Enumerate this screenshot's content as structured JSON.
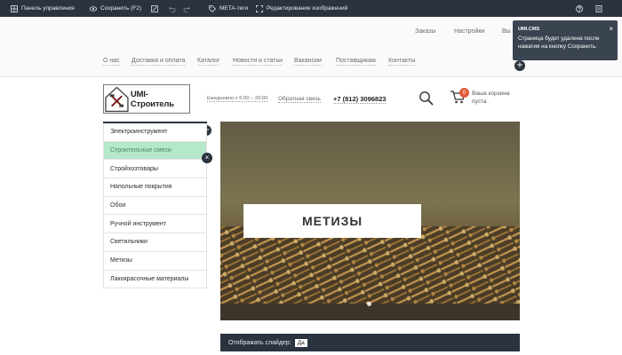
{
  "adminbar": {
    "control_panel": "Панель управления",
    "save": "Сохранить (F2)",
    "meta_tags": "META-теги",
    "edit_images": "Редактирование изображений"
  },
  "topnav": {
    "items": [
      "Заказы",
      "Настройки",
      "Вы"
    ]
  },
  "mainnav": {
    "items": [
      "О нас",
      "Доставка и оплата",
      "Каталог",
      "Новости и статьи",
      "Вакансии",
      "Поставщикам",
      "Контакты"
    ]
  },
  "notification": {
    "title": "UMI.CMS",
    "text": "Страница будет удалена после нажатия на кнопку Сохранить.",
    "close": "×"
  },
  "header": {
    "logo_text": "UMI-Строитель",
    "hours": "Ежедневно с 6:00 – 20:00",
    "callback": "Обратная связь",
    "phone": "+7 (812) 3096823",
    "cart_count": "0",
    "cart_text": "Ваша корзина пуста"
  },
  "sidebar": {
    "items": [
      {
        "label": "Электроинструмент"
      },
      {
        "label": "Строительные смеси"
      },
      {
        "label": "Стройхозтовары"
      },
      {
        "label": "Напольные покрытия"
      },
      {
        "label": "Обои"
      },
      {
        "label": "Ручной инструмент"
      },
      {
        "label": "Светильники"
      },
      {
        "label": "Метизы"
      },
      {
        "label": "Лакокрасочные материалы"
      }
    ],
    "active_index": 1
  },
  "slider": {
    "title": "МЕТИЗЫ",
    "settings_label": "Отображать слайдер:",
    "settings_value": "Да"
  },
  "colors": {
    "admin_bg": "#2b3340",
    "active_item_bg": "#b5e7c9",
    "cart_badge": "#e05a3a"
  },
  "icons": {
    "control_panel": "grid-icon",
    "save": "eye-icon",
    "meta": "tag-icon",
    "edit_images": "crop-icon",
    "help": "help-icon",
    "pages": "document-icon"
  }
}
